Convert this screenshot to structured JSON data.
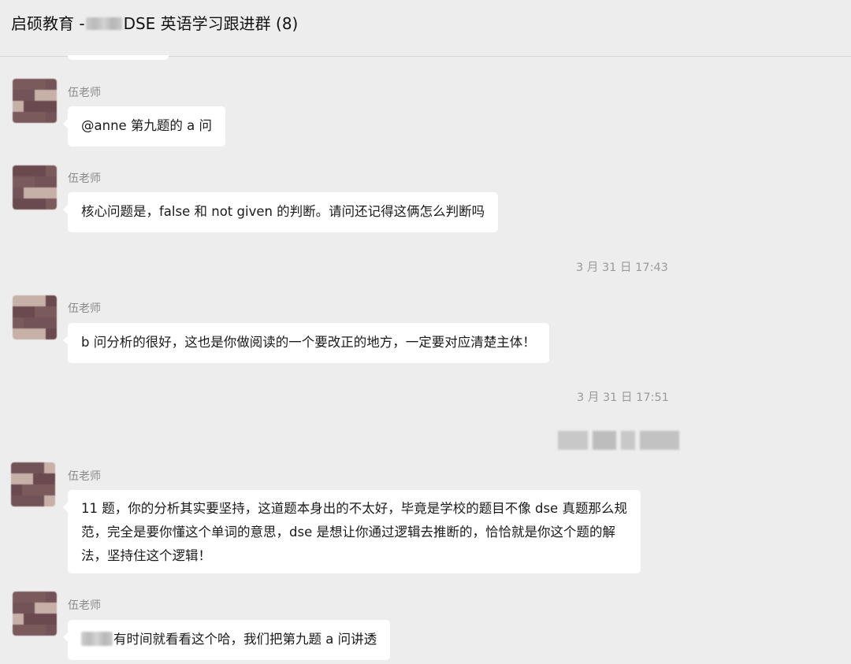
{
  "header": {
    "title_prefix": "启硕教育 -",
    "title_suffix": "DSE 英语学习跟进群 (8)"
  },
  "colors": {
    "background": "#ededed",
    "bubble": "#ffffff",
    "sender_name": "#8a8a8a",
    "timestamp": "#9a9a9a"
  },
  "messages": [
    {
      "sender": "伍老师",
      "text": "@anne 第九题的 a 问"
    },
    {
      "sender": "伍老师",
      "text": "核心问题是，false 和 not given 的判断。请问还记得这俩怎么判断吗"
    },
    {
      "timestamp": "3 月 31 日 17:43"
    },
    {
      "sender": "伍老师",
      "text": "b 问分析的很好，这也是你做阅读的一个要改正的地方，一定要对应清楚主体！"
    },
    {
      "timestamp": "3 月 31 日 17:51"
    },
    {
      "sender": "伍老师",
      "lines": [
        "11 题，你的分析其实要坚持，这道题本身出的不太好，毕竟是学校的题目不像 dse 真题那么规",
        "范，完全是要你懂这个单词的意思，dse 是想让你通过逻辑去推断的，恰恰就是你这个题的解",
        "法，坚持住这个逻辑！"
      ]
    },
    {
      "sender": "伍老师",
      "text": "有时间就看看这个哈，我们把第九题 a 问讲透"
    }
  ]
}
